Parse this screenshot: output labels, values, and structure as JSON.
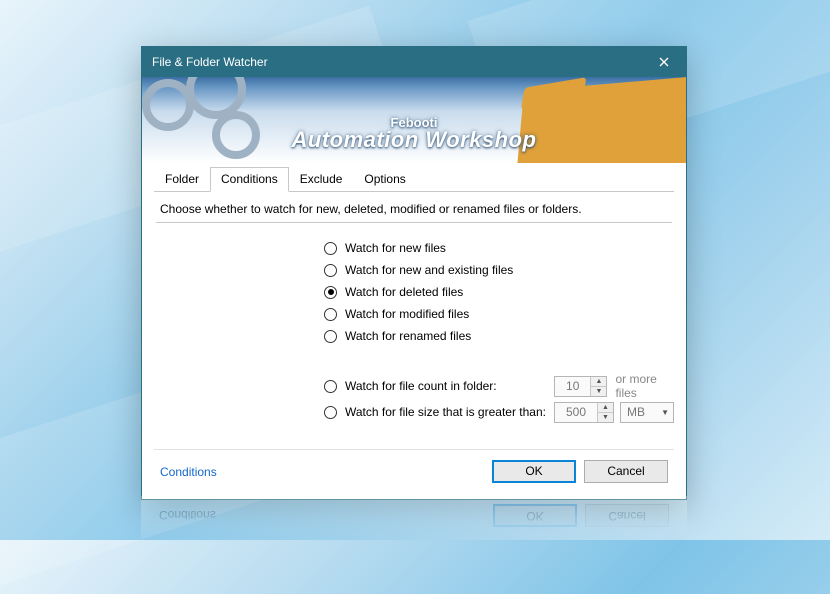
{
  "window": {
    "title": "File & Folder Watcher"
  },
  "brand": {
    "vendor": "Febooti",
    "product": "Automation Workshop"
  },
  "tabs": [
    {
      "id": "folder",
      "label": "Folder",
      "active": false
    },
    {
      "id": "conditions",
      "label": "Conditions",
      "active": true
    },
    {
      "id": "exclude",
      "label": "Exclude",
      "active": false
    },
    {
      "id": "options",
      "label": "Options",
      "active": false
    }
  ],
  "description": "Choose whether to watch for new, deleted, modified or renamed files or folders.",
  "radios": {
    "group1": [
      {
        "id": "new",
        "label": "Watch for new files",
        "selected": false
      },
      {
        "id": "new-existing",
        "label": "Watch for new and existing files",
        "selected": false
      },
      {
        "id": "deleted",
        "label": "Watch for deleted files",
        "selected": true
      },
      {
        "id": "modified",
        "label": "Watch for modified files",
        "selected": false
      },
      {
        "id": "renamed",
        "label": "Watch for renamed files",
        "selected": false
      }
    ],
    "count": {
      "label": "Watch for file count in folder:",
      "value": "10",
      "suffix": "or more files",
      "selected": false
    },
    "size": {
      "label": "Watch for file size that is greater than:",
      "value": "500",
      "unit": "MB",
      "selected": false
    }
  },
  "footer": {
    "help_link": "Conditions",
    "ok": "OK",
    "cancel": "Cancel"
  }
}
